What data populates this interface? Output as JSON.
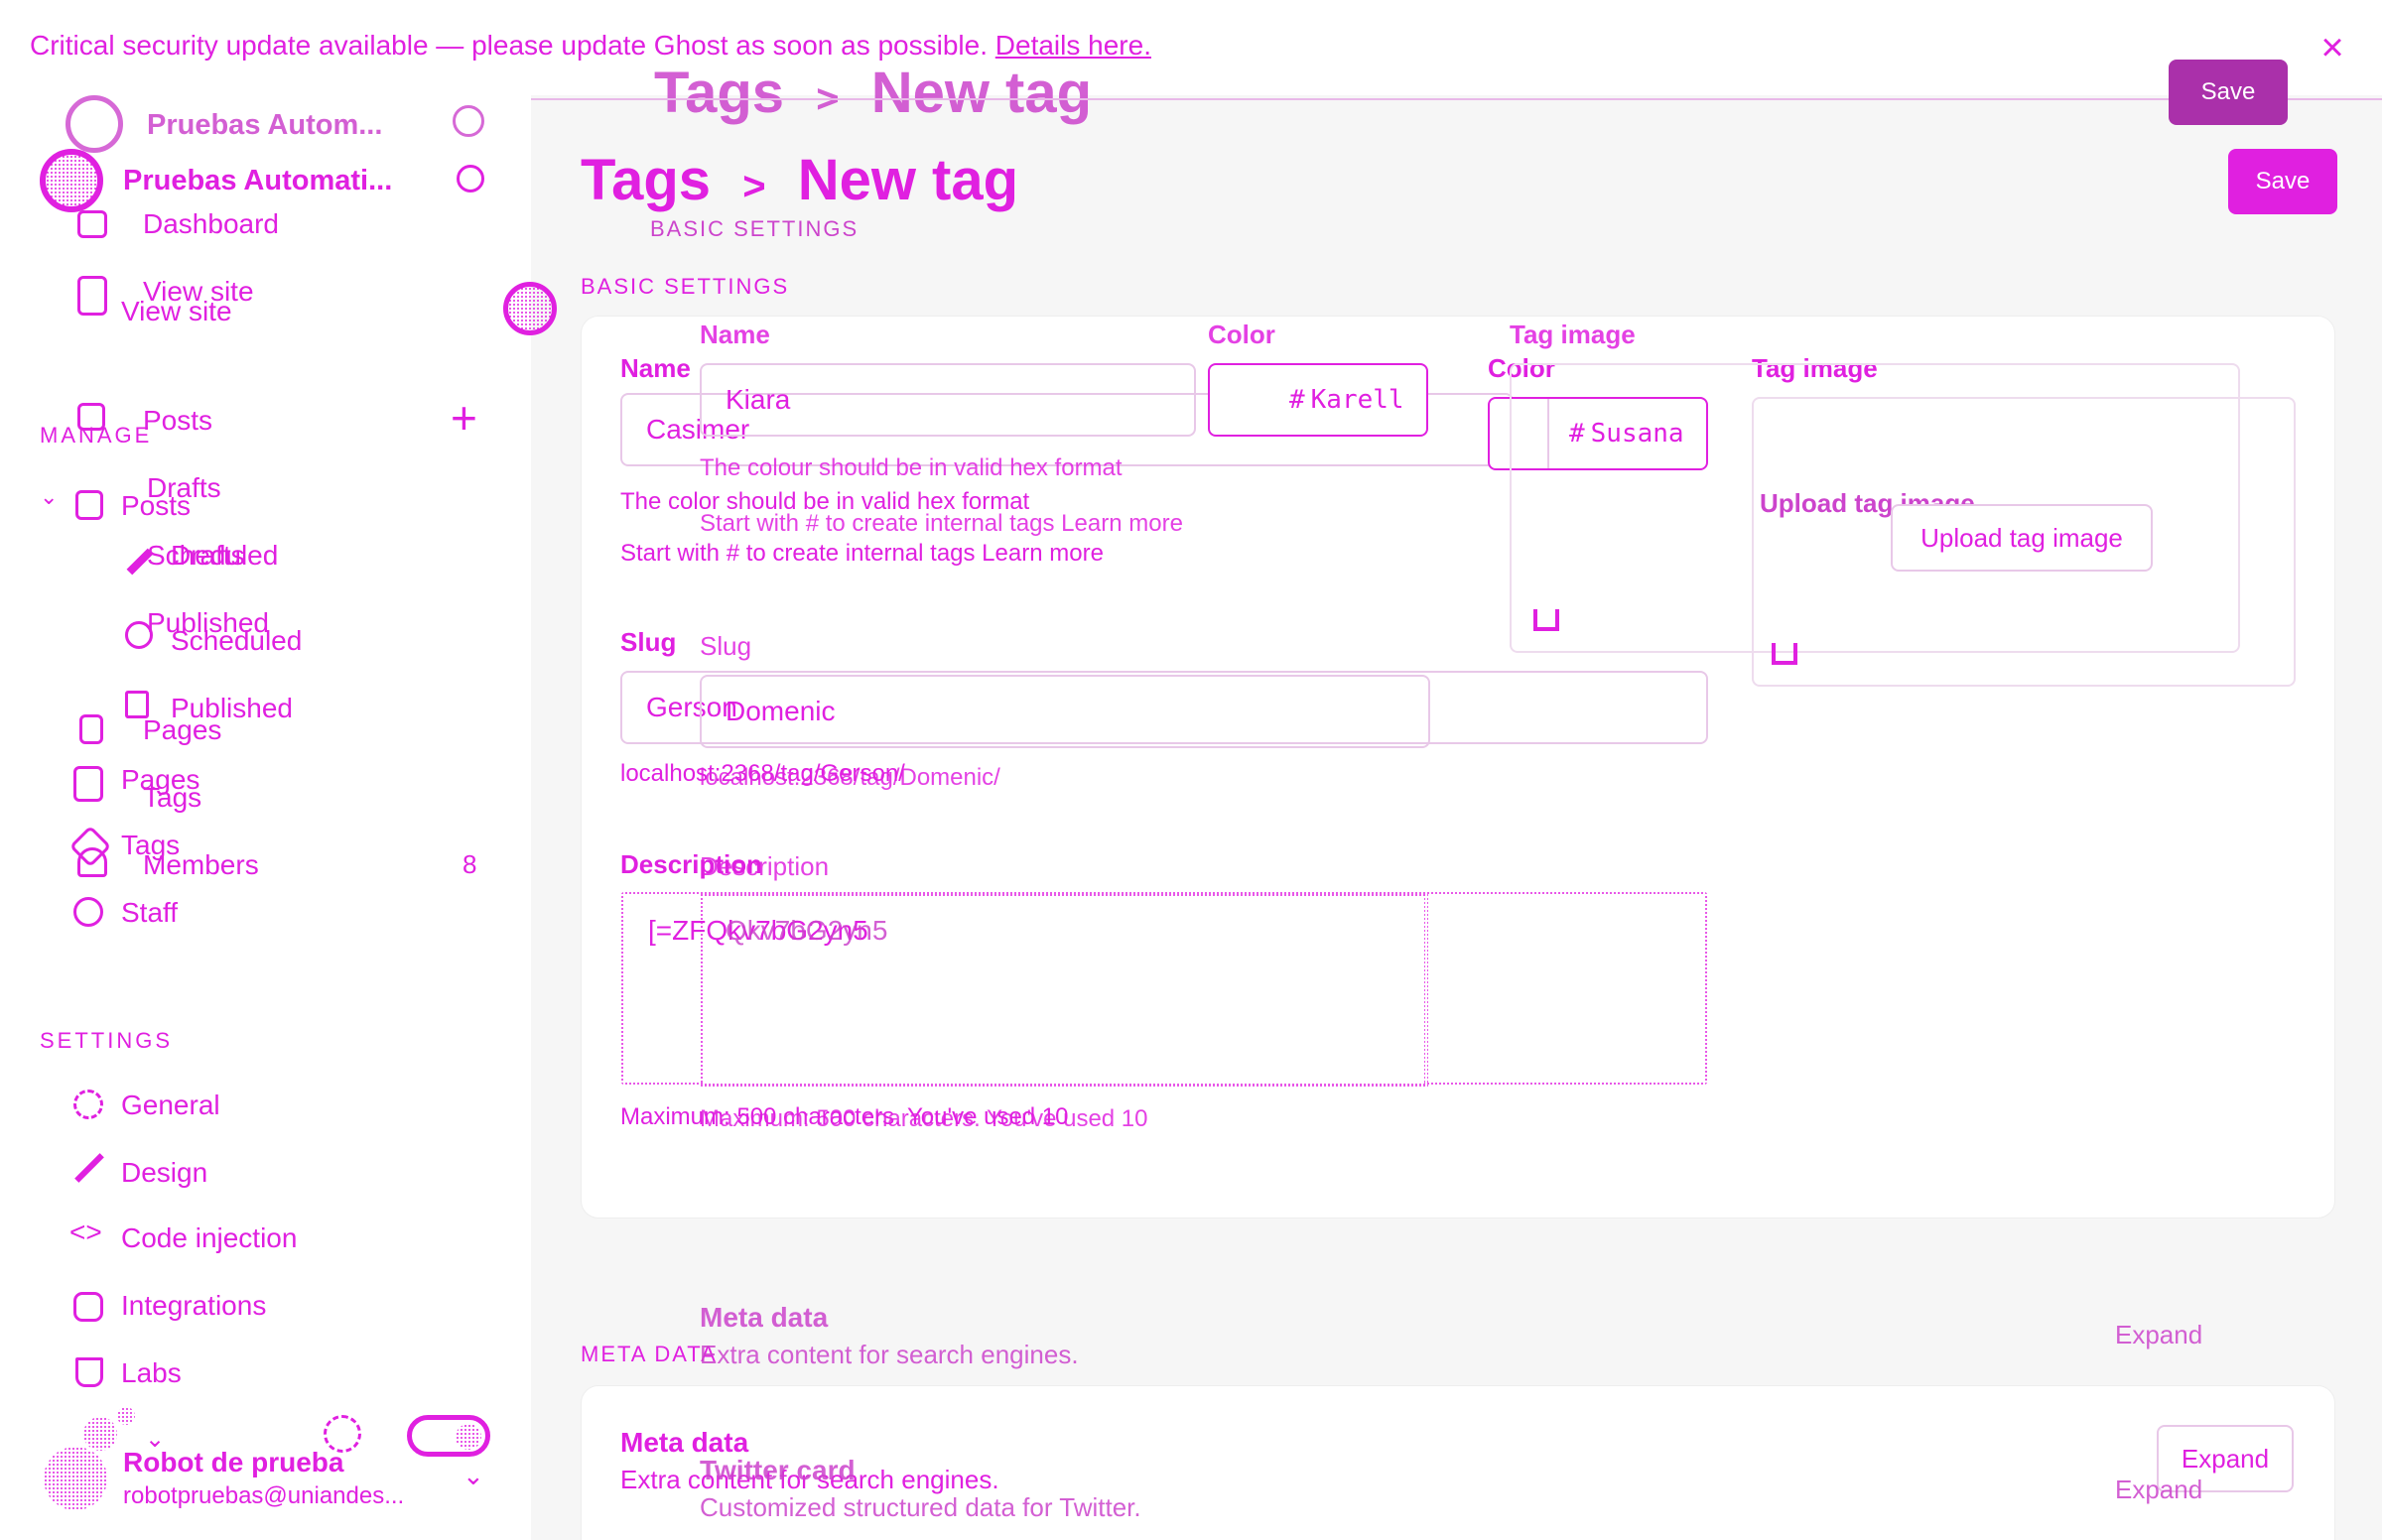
{
  "banner": {
    "text": "Critical security update available — please update Ghost as soon as possible.",
    "link": "Details here.",
    "close": "×"
  },
  "sidebar": {
    "site_name_ghost": "Pruebas Autom...",
    "site_name": "Pruebas Automati...",
    "dashboard": "Dashboard",
    "view_site_a": "View site",
    "view_site_b": "View site",
    "manage_label": "MANAGE",
    "posts_a": "Posts",
    "posts_b": "Posts",
    "drafts_a": "Drafts",
    "drafts_b": "Drafts",
    "scheduled_a": "Scheduled",
    "scheduled_b": "Scheduled",
    "published_a": "Published",
    "published_b": "Published",
    "pages_a": "Pages",
    "pages_b": "Pages",
    "tags_a": "Tags",
    "tags_b": "Tags",
    "members": "Members",
    "members_count": "8",
    "staff": "Staff",
    "settings_label": "SETTINGS",
    "general": "General",
    "design": "Design",
    "code_injection": "Code injection",
    "integrations": "Integrations",
    "labs": "Labs",
    "user_name": "Robot de prueba",
    "user_email": "robotpruebas@uniandes..."
  },
  "header": {
    "breadcrumb_root_ghost": "Tags",
    "breadcrumb_page_ghost": "New tag",
    "breadcrumb_root": "Tags",
    "breadcrumb_page": "New tag",
    "separator": ">",
    "save_ghost": "Save",
    "save": "Save"
  },
  "basic": {
    "section_label_ghost": "BASIC SETTINGS",
    "section_label": "BASIC SETTINGS",
    "name_label_ghost": "Name",
    "name_label": "Name",
    "name_value_ghost": "Kiara",
    "name_value": "Casimer",
    "name_error_ghost": "The colour should be in valid hex format",
    "name_error": "The color should be in valid hex format",
    "name_hint_ghost": "Start with # to create internal tags Learn more",
    "name_hint": "Start with # to create internal tags Learn more",
    "color_label_ghost": "Color",
    "color_label": "Color",
    "color_value_ghost": "Karell",
    "color_value": "Susana",
    "hash": "#",
    "image_label_ghost": "Tag image",
    "image_label": "Tag image",
    "upload_ghost": "Upload tag image",
    "upload": "Upload tag image",
    "slug_label_ghost": "Slug",
    "slug_label": "Slug",
    "slug_value_ghost": "Domenic",
    "slug_value": "Gerson",
    "slug_url_ghost": "localhost:2368/tag/Domenic/",
    "slug_url": "localhost:2368/tag/Gerson/",
    "desc_label_ghost": "Description",
    "desc_label": "Description",
    "desc_value_ghost": "Qkv7bG2yn5",
    "desc_value": "[=ZFQkv7bG2yn5",
    "desc_count_ghost": "Maximum: 500 characters. You've used 10",
    "desc_count": "Maximum: 500 characters. You've used 10"
  },
  "meta": {
    "section_label": "META DATA",
    "title_ghost": "Meta data",
    "title": "Meta data",
    "desc_ghost": "Extra content for search engines.",
    "desc": "Extra content for search engines.",
    "expand_ghost": "Expand",
    "expand": "Expand",
    "twitter_title": "Twitter card",
    "twitter_desc": "Customized structured data for Twitter.",
    "twitter_expand": "Expand"
  }
}
